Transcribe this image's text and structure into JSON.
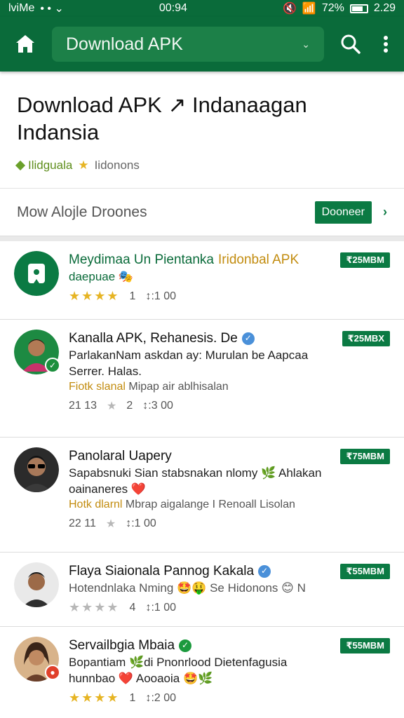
{
  "status_bar": {
    "left_text": "lviMe",
    "time": "00:94",
    "battery": "72%",
    "clock": "2.29"
  },
  "app_bar": {
    "search_value": "Download APK"
  },
  "header": {
    "title": "Download APK ↗ Indanaagan Indansia",
    "tag": "Ilidguala",
    "rating_text": "Iidonons"
  },
  "filter": {
    "label": "Mow Alojle Droones",
    "button": "Dooneer"
  },
  "items": [
    {
      "title_plain": "Meydimaa Un Pientanka ",
      "title_hl": "Iridonbal APK",
      "desc": "daepuae 🎭",
      "sub": "",
      "left_stat": "",
      "rating_count": "1",
      "downloads": "↕:1 00",
      "size": "₹25MBM",
      "avatar": "app-logo"
    },
    {
      "title_plain": "Kanalla APK, Rehanesis. De",
      "title_hl": "",
      "desc": "ParlakanNam askdan ay: Murulan be Aapcaa Serrer. Halas.",
      "sub_hl": "Fiotk slanal",
      "sub": " Mipap air ablhisalan",
      "left_stat": "21 13",
      "rating_count": "2",
      "downloads": "↕:3 00",
      "size": "₹25MBX",
      "avatar": "man-green"
    },
    {
      "title_plain": "Panolaral Uapery",
      "title_hl": "",
      "desc": "Sapabsnuki Sian stabsnakan nlomy 🌿 Ahlakan oainaneres ❤️",
      "sub_hl": "Hotk dlarnl",
      "sub": " Mbrap aigalange I Renoall Lisolan",
      "left_stat": "22 11",
      "rating_count": "",
      "downloads": "↕:1 00",
      "size": "₹75MBM",
      "avatar": "man-glasses"
    },
    {
      "title_plain": "Flaya Siaionala Pannog Kakala",
      "title_hl": "",
      "desc": "Hotendnlaka Nming 🤩🤑 Se Hidonons 😊 N",
      "sub": "",
      "left_stat": "",
      "rating_count": "4",
      "downloads": "↕:1 00",
      "size": "₹55MBM",
      "avatar": "man-young"
    },
    {
      "title_plain": "Servailbgia Mbaia",
      "title_hl": "",
      "desc": "Bopantiam 🌿di Pnonrlood Dietenfagusia hunnbao ❤️ Aooaoia 🤩🌿",
      "sub": "",
      "left_stat": "",
      "rating_count": "1",
      "downloads": "↕:2 00",
      "size": "₹55MBM",
      "avatar": "woman"
    }
  ],
  "colors": {
    "primary": "#0a6b3a",
    "accent": "#0b7a43",
    "star": "#e6b423"
  }
}
